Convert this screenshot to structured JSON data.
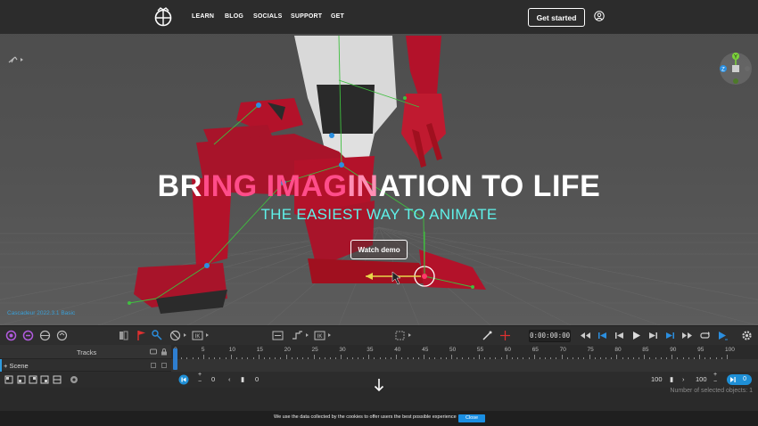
{
  "nav": {
    "links": [
      "LEARN",
      "BLOG",
      "SOCIALS",
      "SUPPORT",
      "GET"
    ],
    "cta_label": "Get started",
    "logo_icon": "cascadeur-logo-icon",
    "user_icon": "user-circle-icon"
  },
  "hero": {
    "title_parts": [
      "BR",
      "ING IMAG",
      "IN",
      "ATION TO LIFE"
    ],
    "subtitle": "THE EASIEST WAY TO ANIMATE",
    "watch_demo_label": "Watch demo",
    "accent_pink": "#ff4d8a",
    "accent_cyan": "#5ff2ea"
  },
  "viewport": {
    "version": "Cascadeur 2022.3.1 Basic",
    "gizmo_axis_y": "Y",
    "gizmo_axis_z": "Z"
  },
  "toolbar": {
    "timecode": "0:00:00:00"
  },
  "timeline": {
    "tracks_label": "Tracks",
    "scene_label": "+ Scene",
    "ruler_ticks": [
      "0",
      "5",
      "10",
      "15",
      "20",
      "25",
      "30",
      "35",
      "40",
      "45",
      "50",
      "55",
      "60",
      "65",
      "70",
      "75",
      "80",
      "85",
      "90",
      "95",
      "100"
    ],
    "start_value": "0",
    "start_value_2": "0",
    "end_value": "100",
    "end_value_2": "100",
    "current_frame": "0",
    "ik_label": "IK"
  },
  "status": {
    "selected_objects": "Number of selected objects: 1"
  },
  "cookie": {
    "text": "We use the data collected by the cookies to offer users the best possible experience",
    "close_label": "Close"
  },
  "colors": {
    "timeline_blue": "#1e8fd6",
    "character_red": "#b3122a"
  }
}
